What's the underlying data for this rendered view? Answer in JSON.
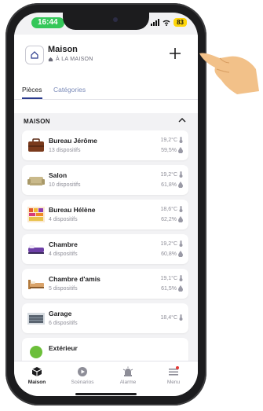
{
  "status": {
    "time": "16:44",
    "battery": "83"
  },
  "header": {
    "title": "Maison",
    "subtitle": "À LA MAISON"
  },
  "tabs": [
    {
      "label": "Pièces",
      "active": true
    },
    {
      "label": "Catégories",
      "active": false
    }
  ],
  "section": {
    "title": "MAISON"
  },
  "rooms": [
    {
      "name": "Bureau Jérôme",
      "devices": "13 dispositifs",
      "temperature": "19,2°C",
      "humidity": "59,5%",
      "icon": "briefcase-icon"
    },
    {
      "name": "Salon",
      "devices": "10 dispositifs",
      "temperature": "19,2°C",
      "humidity": "61,8%",
      "icon": "sofa-icon"
    },
    {
      "name": "Bureau Hélène",
      "devices": "4 dispositifs",
      "temperature": "18,6°C",
      "humidity": "62,2%",
      "icon": "art-print-icon"
    },
    {
      "name": "Chambre",
      "devices": "4 dispositifs",
      "temperature": "19,2°C",
      "humidity": "60,8%",
      "icon": "bed-icon"
    },
    {
      "name": "Chambre d'amis",
      "devices": "5 dispositifs",
      "temperature": "19,1°C",
      "humidity": "61,5%",
      "icon": "guest-bed-icon"
    },
    {
      "name": "Garage",
      "devices": "6 dispositifs",
      "temperature": "18,4°C",
      "humidity": "",
      "icon": "garage-icon"
    },
    {
      "name": "Extérieur",
      "devices": "",
      "temperature": "",
      "humidity": "",
      "icon": "tree-icon"
    }
  ],
  "nav": [
    {
      "label": "Maison",
      "icon": "home-cube-icon",
      "active": true
    },
    {
      "label": "Scénarios",
      "icon": "play-icon",
      "active": false
    },
    {
      "label": "Alarme",
      "icon": "alarm-icon",
      "active": false
    },
    {
      "label": "Menu",
      "icon": "menu-icon",
      "active": false,
      "badge": true
    }
  ],
  "colors": {
    "accent": "#2a3a8c",
    "status_green": "#34c759",
    "battery_yellow": "#ffd60a",
    "badge_red": "#e53935"
  }
}
